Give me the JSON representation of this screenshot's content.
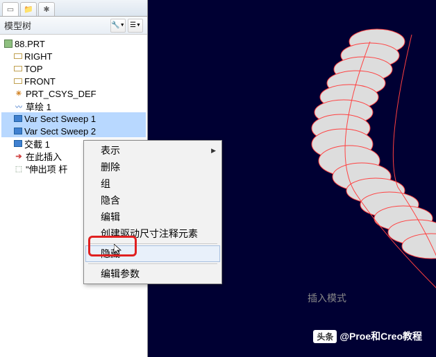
{
  "panel": {
    "title": "模型树"
  },
  "tabs": [
    {
      "glyph": "▭",
      "name": "tab-tree"
    },
    {
      "glyph": "📁",
      "name": "tab-folders"
    },
    {
      "glyph": "✱",
      "name": "tab-favorites"
    }
  ],
  "tools": [
    {
      "glyph": "🔧",
      "name": "tool-settings"
    },
    {
      "glyph": "☰",
      "name": "tool-show"
    }
  ],
  "tree": {
    "root": "88.PRT",
    "items": [
      {
        "label": "RIGHT",
        "icon": "ico-dir",
        "name": "datum-right",
        "sel": false
      },
      {
        "label": "TOP",
        "icon": "ico-dir",
        "name": "datum-top",
        "sel": false
      },
      {
        "label": "FRONT",
        "icon": "ico-dir",
        "name": "datum-front",
        "sel": false
      },
      {
        "label": "PRT_CSYS_DEF",
        "icon": "ico-csys",
        "iconTxt": "✳",
        "name": "csys-def",
        "sel": false
      },
      {
        "label": "草绘 1",
        "icon": "ico-sketch",
        "iconTxt": "〰",
        "name": "sketch-1",
        "sel": false
      },
      {
        "label": "Var Sect Sweep 1",
        "icon": "ico-sweep",
        "name": "var-sweep-1",
        "sel": true
      },
      {
        "label": "Var Sect Sweep 2",
        "icon": "ico-sweep",
        "name": "var-sweep-2",
        "sel": true
      },
      {
        "label": "交截 1",
        "icon": "ico-sweep",
        "name": "intersect-1",
        "sel": false
      },
      {
        "label": "在此插入",
        "icon": "ico-arrow",
        "iconTxt": "➔",
        "name": "insert-here",
        "sel": false
      },
      {
        "label": "\"伸出项 杆",
        "icon": "ico-extrude",
        "iconTxt": "⬚",
        "name": "extrude-item",
        "sel": false
      }
    ]
  },
  "context_menu": [
    {
      "label": "表示",
      "sub": true,
      "name": "menu-represent"
    },
    {
      "label": "删除",
      "name": "menu-delete"
    },
    {
      "label": "组",
      "name": "menu-group"
    },
    {
      "label": "隐含",
      "name": "menu-suppress"
    },
    {
      "label": "编辑",
      "name": "menu-edit"
    },
    {
      "label": "创建驱动尺寸注释元素",
      "name": "menu-create-driving-dim"
    },
    {
      "sep": true
    },
    {
      "label": "隐藏",
      "name": "menu-hide",
      "hovered": true
    },
    {
      "sep": true
    },
    {
      "label": "编辑参数",
      "name": "menu-edit-params"
    }
  ],
  "viewport": {
    "insert_mode": "插入模式"
  },
  "watermark": {
    "chip": "头条",
    "text": "@Proe和Creo教程"
  }
}
